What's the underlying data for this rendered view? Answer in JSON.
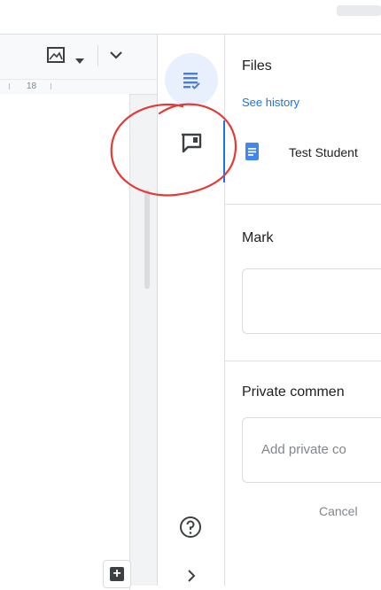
{
  "toolbar": {
    "image_tool_icon": "image-icon",
    "dropdown_icon": "arrow-drop-down-icon",
    "more_icon": "chevron-down-icon"
  },
  "ruler": {
    "number": "18"
  },
  "rail": {
    "files_icon": "assignment-files-icon",
    "comment_icon": "comment-icon",
    "help_icon": "help-icon",
    "expand_icon": "chevron-right-icon"
  },
  "panel": {
    "files_title": "Files",
    "see_history": "See history",
    "file": {
      "name": "Test Student",
      "icon": "google-docs-icon"
    },
    "mark_label": "Mark",
    "mark_value": "",
    "private_comments_label": "Private commen",
    "private_comment_placeholder": "Add private co",
    "cancel_label": "Cancel"
  },
  "colors": {
    "accent": "#1a73e8",
    "annotation": "#e53935"
  }
}
